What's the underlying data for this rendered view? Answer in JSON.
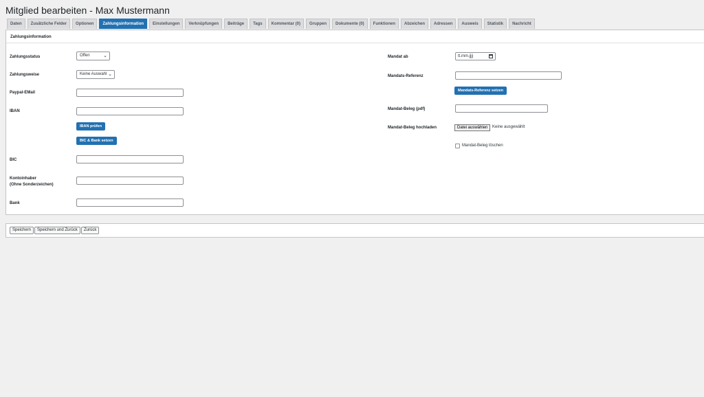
{
  "page": {
    "title": "Mitglied bearbeiten - Max Mustermann"
  },
  "tabs": [
    {
      "label": "Daten",
      "active": false
    },
    {
      "label": "Zusätzliche Felder",
      "active": false
    },
    {
      "label": "Optionen",
      "active": false
    },
    {
      "label": "Zahlungsinformation",
      "active": true
    },
    {
      "label": "Einstellungen",
      "active": false
    },
    {
      "label": "Verknüpfungen",
      "active": false
    },
    {
      "label": "Beiträge",
      "active": false
    },
    {
      "label": "Tags",
      "active": false
    },
    {
      "label": "Kommentar (0)",
      "active": false
    },
    {
      "label": "Gruppen",
      "active": false
    },
    {
      "label": "Dokumente (0)",
      "active": false
    },
    {
      "label": "Funktionen",
      "active": false
    },
    {
      "label": "Abzeichen",
      "active": false
    },
    {
      "label": "Adressen",
      "active": false
    },
    {
      "label": "Ausweis",
      "active": false
    },
    {
      "label": "Statistik",
      "active": false
    },
    {
      "label": "Nachricht",
      "active": false
    }
  ],
  "panel": {
    "heading": "Zahlungsinformation"
  },
  "left": {
    "zahlungsstatus_label": "Zahlungsstatus",
    "zahlungsstatus_value": "Offen",
    "zahlungsweise_label": "Zahlungsweise",
    "zahlungsweise_value": "Keine Auswahl",
    "paypal_label": "Paypal-EMail",
    "paypal_value": "",
    "iban_label": "IBAN",
    "iban_value": "",
    "iban_check_button": "IBAN prüfen",
    "bic_bank_button": "BIC & Bank setzen",
    "bic_label": "BIC",
    "bic_value": "",
    "kontoinhaber_label_line1": "Kontoinhaber",
    "kontoinhaber_label_line2": "(Ohne Sonderzeichen)",
    "kontoinhaber_value": "",
    "bank_label": "Bank",
    "bank_value": ""
  },
  "right": {
    "mandat_ab_label": "Mandat ab",
    "mandat_ab_value": "tt.mm.jjjj",
    "mandats_referenz_label": "Mandats-Referenz",
    "mandats_referenz_value": "",
    "mandats_referenz_button": "Mandats-Referenz setzen",
    "mandat_beleg_label": "Mandat-Beleg (pdf)",
    "mandat_beleg_value": "",
    "mandat_beleg_upload_label": "Mandat-Beleg hochladen",
    "file_button": "Datei auswählen",
    "file_status": "Keine ausgewählt",
    "delete_checkbox_label": "Mandat-Beleg löschen",
    "delete_checked": false
  },
  "footer": {
    "save": "Speichern",
    "save_back": "Speichern und Zurück",
    "back": "Zurück"
  },
  "colors": {
    "accent": "#2271b1",
    "background": "#f0f0f1"
  }
}
